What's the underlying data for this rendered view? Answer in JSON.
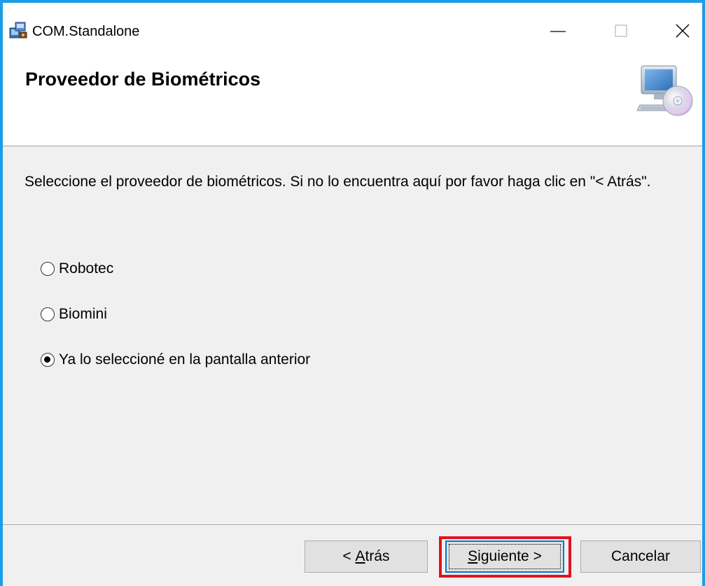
{
  "window": {
    "title": "COM.Standalone"
  },
  "titlebar_buttons": {
    "minimize_icon": "minimize-icon",
    "maximize_icon": "maximize-icon",
    "close_icon": "close-icon"
  },
  "header": {
    "title": "Proveedor de Biométricos",
    "icon": "computer-cd-icon"
  },
  "content": {
    "instruction": "Seleccione el proveedor de biométricos. Si no lo encuentra aquí por favor haga clic en \"< Atrás\".",
    "options": [
      {
        "label": "Robotec",
        "checked": false
      },
      {
        "label": "Biomini",
        "checked": false
      },
      {
        "label": "Ya lo seleccioné en la pantalla anterior",
        "checked": true
      }
    ]
  },
  "buttons": {
    "back_prefix": "< ",
    "back_accel": "A",
    "back_rest": "trás",
    "next_accel": "S",
    "next_rest": "iguiente >",
    "cancel": "Cancelar"
  },
  "colors": {
    "window_border": "#1a9ee6",
    "highlight": "#e3121f"
  }
}
